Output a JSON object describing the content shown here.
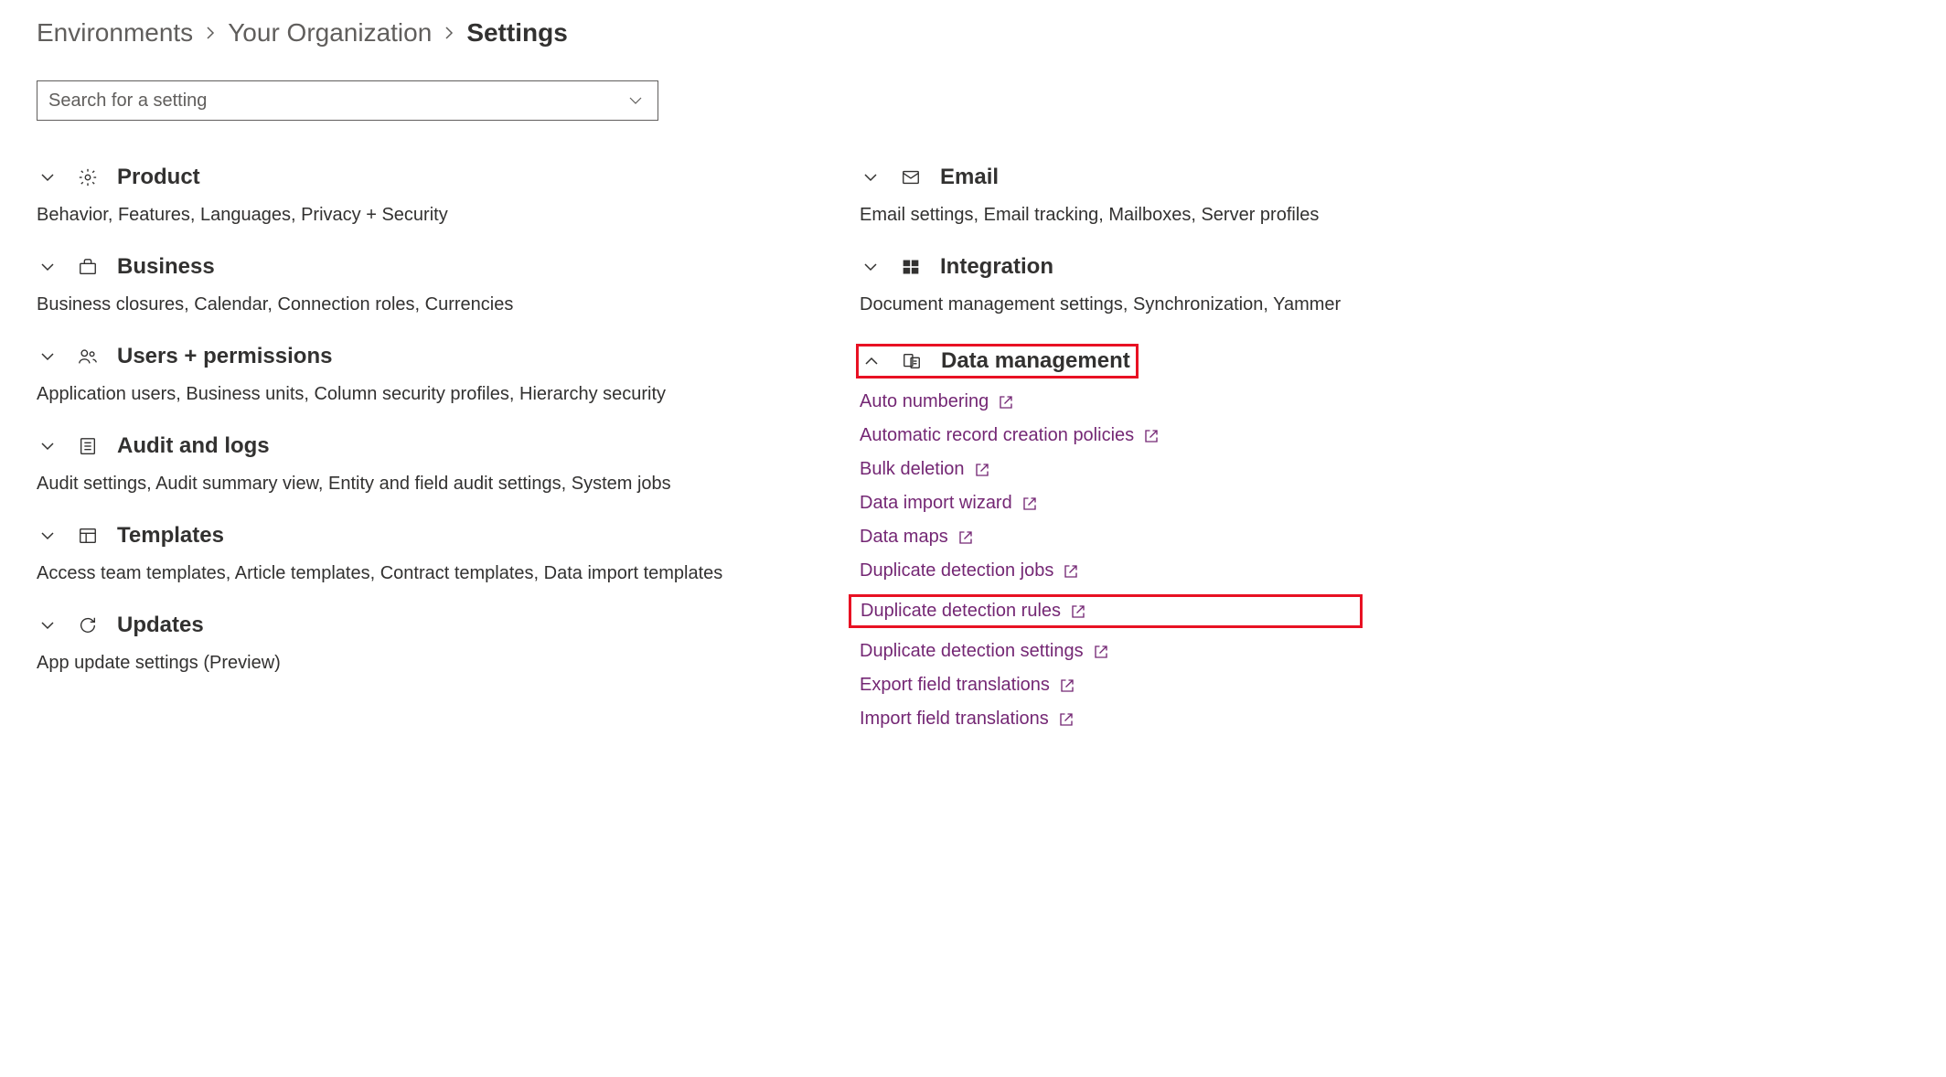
{
  "breadcrumb": {
    "environments": "Environments",
    "org": "Your Organization",
    "settings": "Settings"
  },
  "search": {
    "placeholder": "Search for a setting"
  },
  "sections": {
    "product": {
      "title": "Product",
      "description": "Behavior, Features, Languages, Privacy + Security"
    },
    "business": {
      "title": "Business",
      "description": "Business closures, Calendar, Connection roles, Currencies"
    },
    "users": {
      "title": "Users + permissions",
      "description": "Application users, Business units, Column security profiles, Hierarchy security"
    },
    "audit": {
      "title": "Audit and logs",
      "description": "Audit settings, Audit summary view, Entity and field audit settings, System jobs"
    },
    "templates": {
      "title": "Templates",
      "description": "Access team templates, Article templates, Contract templates, Data import templates"
    },
    "updates": {
      "title": "Updates",
      "description": "App update settings (Preview)"
    },
    "email": {
      "title": "Email",
      "description": "Email settings, Email tracking, Mailboxes, Server profiles"
    },
    "integration": {
      "title": "Integration",
      "description": "Document management settings, Synchronization, Yammer"
    },
    "data_management": {
      "title": "Data management",
      "links": [
        "Auto numbering",
        "Automatic record creation policies",
        "Bulk deletion",
        "Data import wizard",
        "Data maps",
        "Duplicate detection jobs",
        "Duplicate detection rules",
        "Duplicate detection settings",
        "Export field translations",
        "Import field translations"
      ]
    }
  }
}
